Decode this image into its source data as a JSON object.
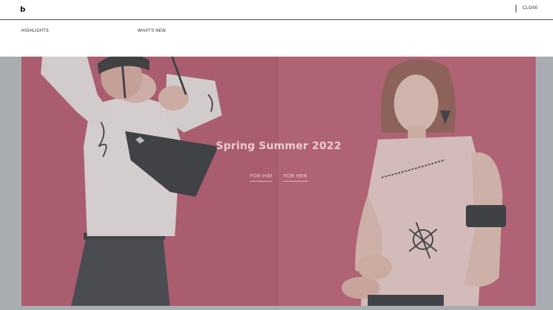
{
  "menu": {
    "logo": "b",
    "close_label": "CLOSE",
    "nav": [
      {
        "label": "HIGHLIGHTS"
      },
      {
        "label": "WHAT'S NEW"
      }
    ]
  },
  "hero": {
    "title": "Spring Summer 2022",
    "links": [
      {
        "label": "FOR HIM"
      },
      {
        "label": "FOR HER"
      }
    ]
  },
  "colors": {
    "backdrop": "#a9adb2",
    "hero_red": "#b8465a",
    "menu_bg": "#ffffff"
  }
}
